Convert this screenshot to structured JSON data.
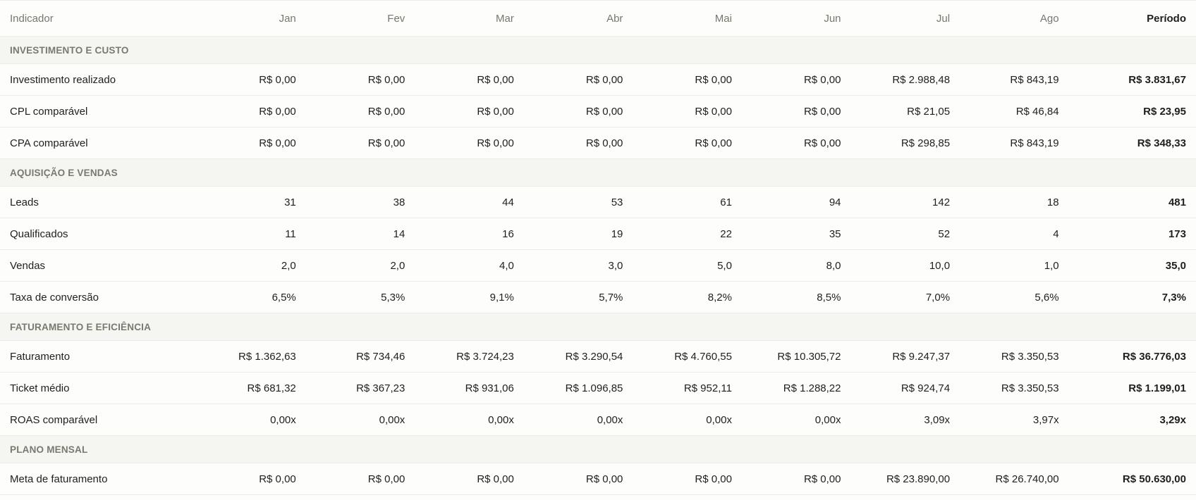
{
  "header": {
    "indicator": "Indicador",
    "months": [
      "Jan",
      "Fev",
      "Mar",
      "Abr",
      "Mai",
      "Jun",
      "Jul",
      "Ago"
    ],
    "period": "Período"
  },
  "sections": [
    {
      "title": "INVESTIMENTO E CUSTO",
      "rows": [
        {
          "label": "Investimento realizado",
          "values": [
            "R$ 0,00",
            "R$ 0,00",
            "R$ 0,00",
            "R$ 0,00",
            "R$ 0,00",
            "R$ 0,00",
            "R$ 2.988,48",
            "R$ 843,19"
          ],
          "total": "R$ 3.831,67"
        },
        {
          "label": "CPL comparável",
          "values": [
            "R$ 0,00",
            "R$ 0,00",
            "R$ 0,00",
            "R$ 0,00",
            "R$ 0,00",
            "R$ 0,00",
            "R$ 21,05",
            "R$ 46,84"
          ],
          "total": "R$ 23,95"
        },
        {
          "label": "CPA comparável",
          "values": [
            "R$ 0,00",
            "R$ 0,00",
            "R$ 0,00",
            "R$ 0,00",
            "R$ 0,00",
            "R$ 0,00",
            "R$ 298,85",
            "R$ 843,19"
          ],
          "total": "R$ 348,33"
        }
      ]
    },
    {
      "title": "AQUISIÇÃO E VENDAS",
      "rows": [
        {
          "label": "Leads",
          "values": [
            "31",
            "38",
            "44",
            "53",
            "61",
            "94",
            "142",
            "18"
          ],
          "total": "481"
        },
        {
          "label": "Qualificados",
          "values": [
            "11",
            "14",
            "16",
            "19",
            "22",
            "35",
            "52",
            "4"
          ],
          "total": "173"
        },
        {
          "label": "Vendas",
          "values": [
            "2,0",
            "2,0",
            "4,0",
            "3,0",
            "5,0",
            "8,0",
            "10,0",
            "1,0"
          ],
          "total": "35,0"
        },
        {
          "label": "Taxa de conversão",
          "values": [
            "6,5%",
            "5,3%",
            "9,1%",
            "5,7%",
            "8,2%",
            "8,5%",
            "7,0%",
            "5,6%"
          ],
          "total": "7,3%"
        }
      ]
    },
    {
      "title": "FATURAMENTO E EFICIÊNCIA",
      "rows": [
        {
          "label": "Faturamento",
          "values": [
            "R$ 1.362,63",
            "R$ 734,46",
            "R$ 3.724,23",
            "R$ 3.290,54",
            "R$ 4.760,55",
            "R$ 10.305,72",
            "R$ 9.247,37",
            "R$ 3.350,53"
          ],
          "total": "R$ 36.776,03"
        },
        {
          "label": "Ticket médio",
          "values": [
            "R$ 681,32",
            "R$ 367,23",
            "R$ 931,06",
            "R$ 1.096,85",
            "R$ 952,11",
            "R$ 1.288,22",
            "R$ 924,74",
            "R$ 3.350,53"
          ],
          "total": "R$ 1.199,01"
        },
        {
          "label": "ROAS comparável",
          "values": [
            "0,00x",
            "0,00x",
            "0,00x",
            "0,00x",
            "0,00x",
            "0,00x",
            "3,09x",
            "3,97x"
          ],
          "total": "3,29x"
        }
      ]
    },
    {
      "title": "PLANO MENSAL",
      "rows": [
        {
          "label": "Meta de faturamento",
          "values": [
            "R$ 0,00",
            "R$ 0,00",
            "R$ 0,00",
            "R$ 0,00",
            "R$ 0,00",
            "R$ 0,00",
            "R$ 23.890,00",
            "R$ 26.740,00"
          ],
          "total": "R$ 50.630,00"
        }
      ]
    }
  ]
}
